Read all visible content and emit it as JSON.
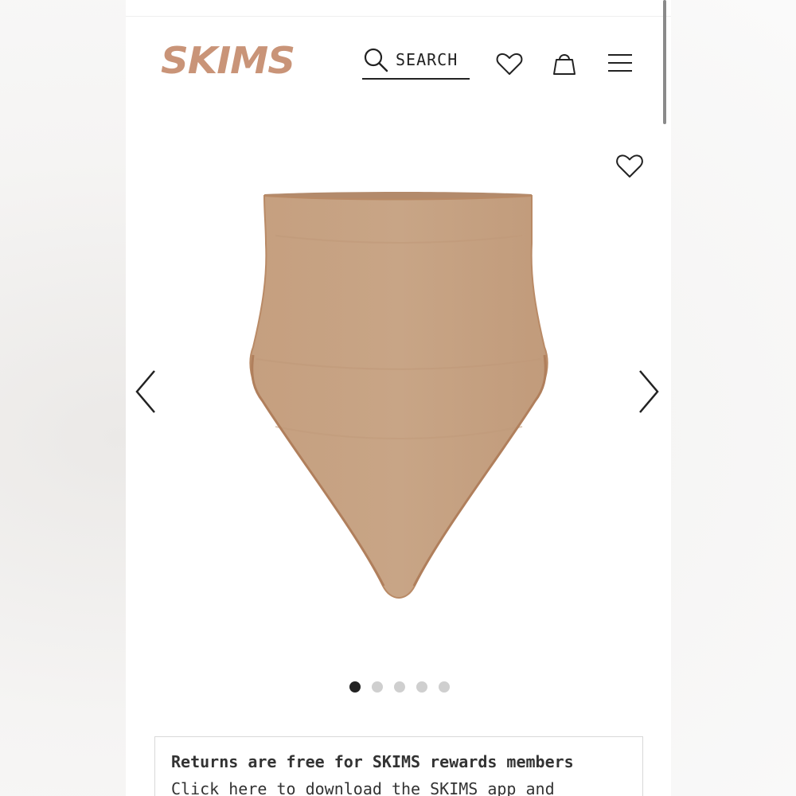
{
  "header": {
    "logo_text": "SKIMS",
    "logo_color": "#c99478",
    "search_label": "SEARCH"
  },
  "icons": {
    "search": "search-icon",
    "wishlist": "heart-icon",
    "bag": "shopping-bag-icon",
    "menu": "hamburger-menu-icon",
    "favorite": "heart-icon",
    "prev": "chevron-left-icon",
    "next": "chevron-right-icon"
  },
  "product": {
    "image_color": "#c6a283",
    "carousel": {
      "total_slides": 5,
      "active_slide": 1
    }
  },
  "notice": {
    "title": "Returns are free for SKIMS rewards members",
    "body": "Click here to download the SKIMS app and"
  }
}
